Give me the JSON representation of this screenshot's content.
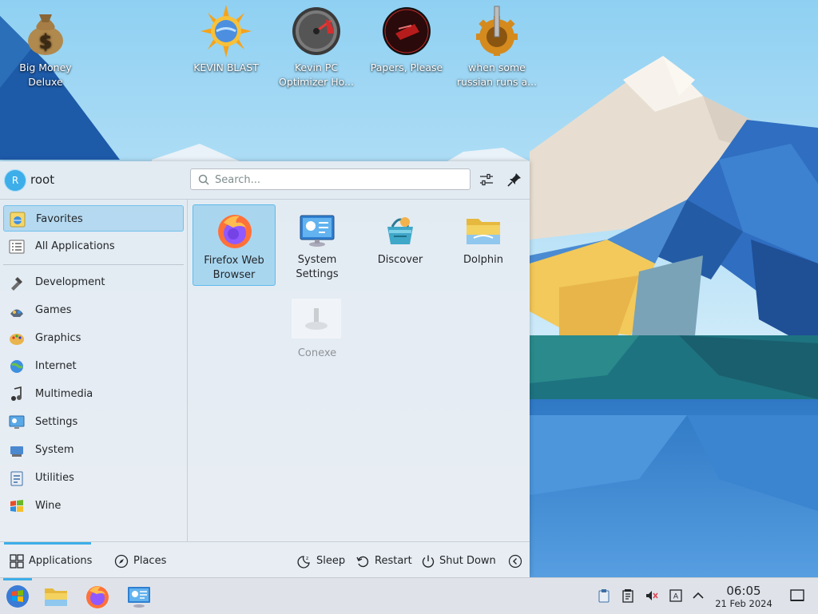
{
  "desktop": {
    "icons": [
      {
        "label": "Big Money Deluxe",
        "icon": "money-bag-icon"
      },
      {
        "label": "KEVIN BLAST",
        "icon": "sun-globe-icon"
      },
      {
        "label": "Kevin PC Optimizer Ho...",
        "icon": "speedometer-icon"
      },
      {
        "label": "Papers, Please",
        "icon": "papers-please-icon"
      },
      {
        "label": "when some russian runs a...",
        "icon": "gear-lever-icon"
      }
    ]
  },
  "launcher": {
    "user": {
      "initial": "R",
      "name": "root"
    },
    "search": {
      "placeholder": "Search..."
    },
    "sidebar": {
      "top_items": [
        {
          "label": "Favorites",
          "icon": "favorites-icon",
          "active": true
        },
        {
          "label": "All Applications",
          "icon": "all-applications-icon",
          "active": false
        }
      ],
      "categories": [
        {
          "label": "Development",
          "icon": "development-icon"
        },
        {
          "label": "Games",
          "icon": "games-icon"
        },
        {
          "label": "Graphics",
          "icon": "graphics-icon"
        },
        {
          "label": "Internet",
          "icon": "internet-icon"
        },
        {
          "label": "Multimedia",
          "icon": "multimedia-icon"
        },
        {
          "label": "Settings",
          "icon": "settings-icon"
        },
        {
          "label": "System",
          "icon": "system-icon"
        },
        {
          "label": "Utilities",
          "icon": "utilities-icon"
        },
        {
          "label": "Wine",
          "icon": "wine-icon"
        }
      ]
    },
    "favorites": [
      {
        "label": "Firefox Web Browser",
        "icon": "firefox-icon",
        "active": true
      },
      {
        "label": "System Settings",
        "icon": "system-settings-icon",
        "active": false
      },
      {
        "label": "Discover",
        "icon": "discover-icon",
        "active": false
      },
      {
        "label": "Dolphin",
        "icon": "dolphin-folder-icon",
        "active": false
      },
      {
        "label": "Conexe",
        "icon": "conexe-icon",
        "active": false,
        "faded": true
      }
    ],
    "footer": {
      "tabs": [
        {
          "label": "Applications",
          "icon": "grid-icon",
          "active": true
        },
        {
          "label": "Places",
          "icon": "compass-icon",
          "active": false
        }
      ],
      "power": [
        {
          "label": "Sleep",
          "icon": "sleep-icon"
        },
        {
          "label": "Restart",
          "icon": "restart-icon"
        },
        {
          "label": "Shut Down",
          "icon": "shutdown-icon"
        }
      ]
    }
  },
  "taskbar": {
    "tasks": [
      {
        "name": "application-launcher",
        "icon": "start-icon"
      },
      {
        "name": "dolphin",
        "icon": "folder-icon"
      },
      {
        "name": "firefox",
        "icon": "firefox-icon"
      },
      {
        "name": "system-settings",
        "icon": "system-settings-icon"
      }
    ],
    "tray": [
      "clipboard-icon",
      "notes-icon",
      "volume-muted-icon",
      "keyboard-layout-icon",
      "expand-arrow-icon"
    ],
    "clock": {
      "time": "06:05",
      "date": "21 Feb 2024"
    }
  },
  "colors": {
    "accent": "#3daee9"
  }
}
